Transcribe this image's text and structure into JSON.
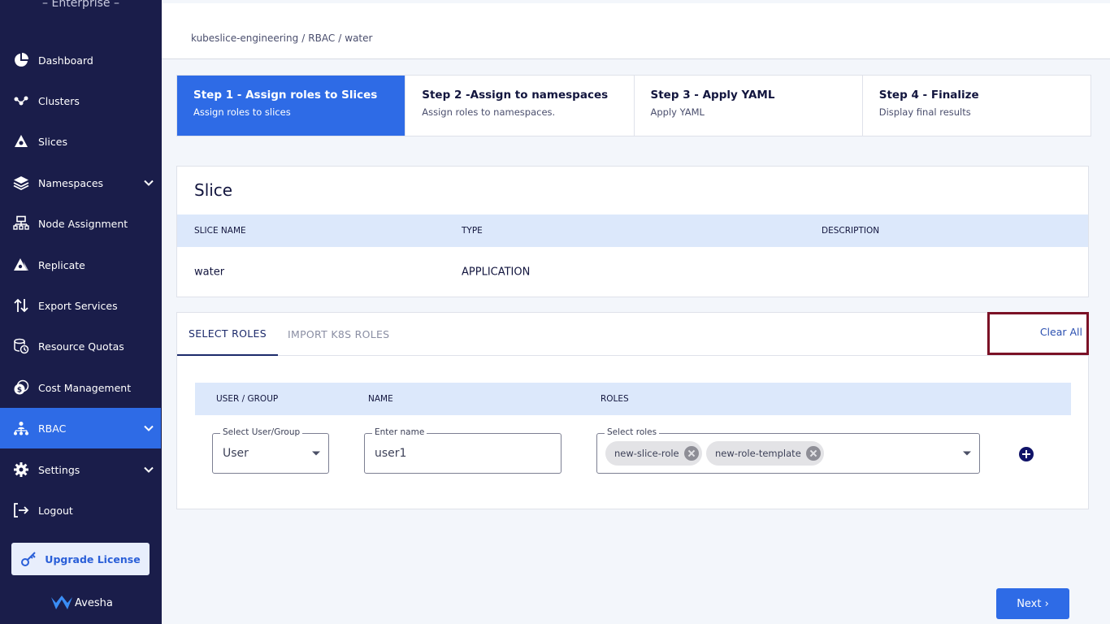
{
  "sidebar": {
    "brand_text": "– Enterprise –",
    "items": [
      {
        "label": "Dashboard",
        "icon": "pie-chart-icon"
      },
      {
        "label": "Clusters",
        "icon": "cluster-icon"
      },
      {
        "label": "Slices",
        "icon": "slice-icon"
      },
      {
        "label": "Namespaces",
        "icon": "layers-icon"
      },
      {
        "label": "Node Assignment",
        "icon": "node-icon"
      },
      {
        "label": "Replicate",
        "icon": "replicate-icon"
      },
      {
        "label": "Export Services",
        "icon": "arrows-updown-icon"
      },
      {
        "label": "Resource Quotas",
        "icon": "quota-icon"
      },
      {
        "label": "Cost Management",
        "icon": "cost-icon"
      },
      {
        "label": "RBAC",
        "icon": "rbac-icon"
      },
      {
        "label": "Settings",
        "icon": "gear-icon"
      },
      {
        "label": "Logout",
        "icon": "logout-icon"
      }
    ],
    "upgrade_label": "Upgrade License",
    "logo_text": "Avesha",
    "active_color": "#2e6be6",
    "bg_color": "#1a1d4a"
  },
  "breadcrumb": {
    "project": "kubeslice-engineering",
    "section": "RBAC",
    "current": "water",
    "separator": "/"
  },
  "steps": [
    {
      "title": "Step 1 - Assign roles to Slices",
      "subtitle": "Assign roles to slices"
    },
    {
      "title": "Step 2 -Assign to namespaces",
      "subtitle": "Assign roles to namespaces."
    },
    {
      "title": "Step 3 - Apply YAML",
      "subtitle": "Apply YAML"
    },
    {
      "title": "Step 4 - Finalize",
      "subtitle": "Display final results"
    }
  ],
  "slice": {
    "title": "Slice",
    "columns": [
      "SLICE NAME",
      "TYPE",
      "DESCRIPTION"
    ],
    "row": {
      "name": "water",
      "type": "APPLICATION",
      "description": ""
    }
  },
  "roles": {
    "tabs": [
      "SELECT ROLES",
      "IMPORT K8S ROLES"
    ],
    "clear_all": "Clear All",
    "columns": [
      "USER / GROUP",
      "NAME",
      "ROLES"
    ],
    "user_group": {
      "legend": "Select User/Group",
      "value": "User"
    },
    "name": {
      "legend": "Enter name",
      "value": "user1"
    },
    "select_roles": {
      "legend": "Select roles",
      "chips": [
        "new-slice-role",
        "new-role-template"
      ]
    }
  },
  "next_label": "Next ›"
}
